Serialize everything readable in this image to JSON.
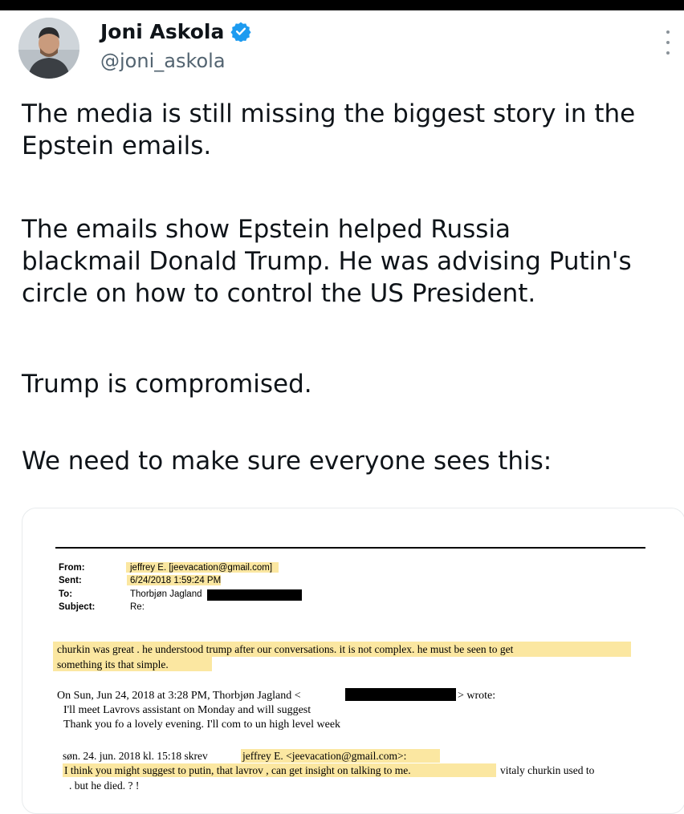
{
  "author": {
    "name": "Joni Askola",
    "handle": "@joni_askola",
    "verified_color": "#1d9bf0"
  },
  "tweet": {
    "p1": "The media is still missing the biggest story in the\nEpstein emails.",
    "p2": "The emails show Epstein helped Russia\nblackmail Donald Trump. He was advising Putin's\ncircle on how to control the US President.",
    "p3": "Trump is compromised.",
    "p4": "We need to make sure everyone sees this:"
  },
  "email": {
    "header_labels": {
      "from": "From:",
      "sent": "Sent:",
      "to": "To:",
      "subject": "Subject:"
    },
    "header_values": {
      "from": "jeffrey E. [jeevacation@gmail.com]",
      "sent": "6/24/2018 1:59:24 PM",
      "to": "Thorbjøn Jagland",
      "subject": "Re:"
    },
    "body_line1": "churkin was great .  he understood trump after our conversations.   it is not complex.   he must be seen to get",
    "body_line2": "something   its that simple.",
    "quote_intro_a": "On Sun, Jun 24, 2018 at 3:28 PM, Thorbjøn Jagland <",
    "quote_intro_b": "> wrote:",
    "quote_line1": "I'll meet Lavrovs assistant on Monday and will suggest",
    "quote_line2": "Thank you fo a lovely evening. I'll com to un high level week",
    "nested_intro_a": "søn. 24. jun. 2018 kl. 15:18 skrev",
    "nested_intro_b": "jeffrey E. <jeevacation@gmail.com>:",
    "nested_line1a": "I think you might suggest to putin,  that lavrov , can get insight on talking to me.",
    "nested_line1b": "vitaly churkin  used to",
    "nested_line2": ".  but he died. ? !"
  }
}
